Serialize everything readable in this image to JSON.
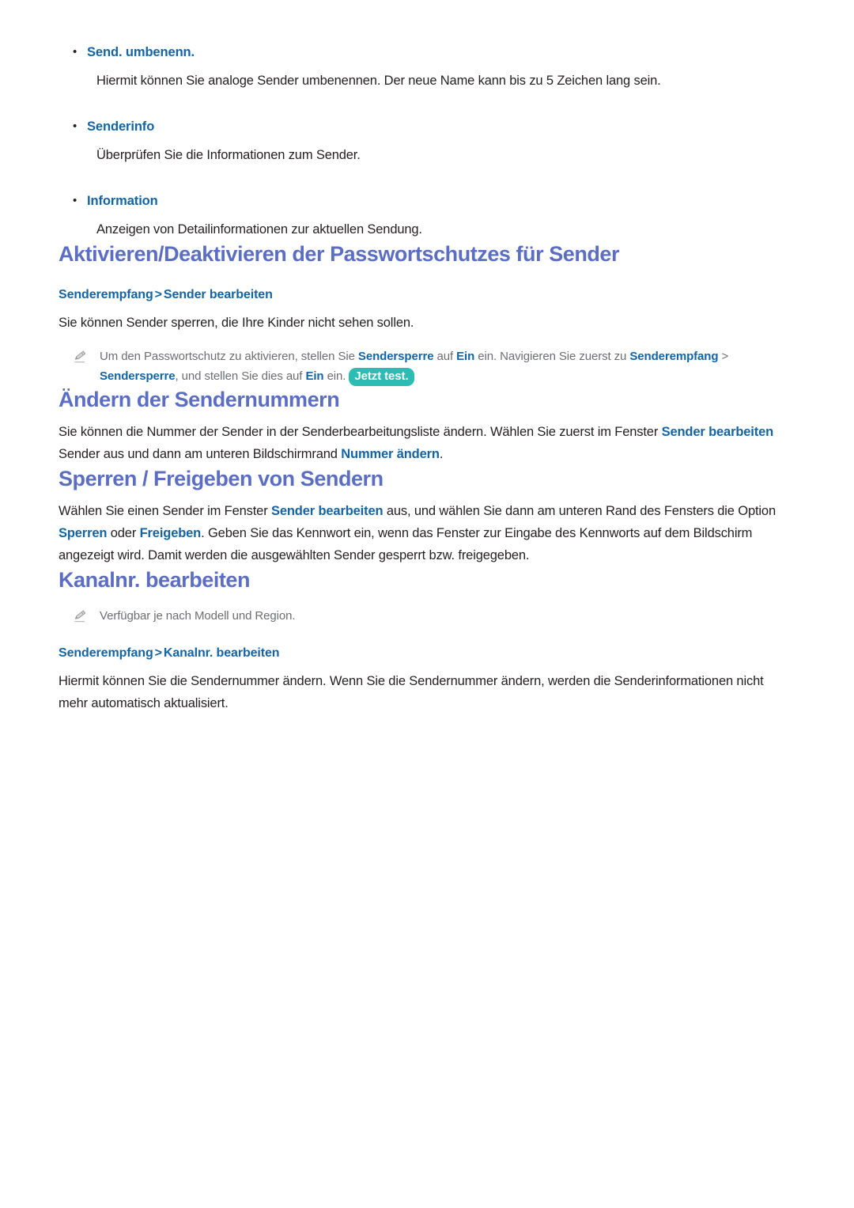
{
  "page": {
    "background_color": "#ffffff",
    "text_color": "#231f20",
    "heading_color": "#5b6ec3",
    "link_color": "#1364a5",
    "note_text_color": "#6d6e71",
    "badge_color": "#2cbcb3"
  },
  "bullets": [
    {
      "label": "Send. umbenenn.",
      "description": "Hiermit können Sie analoge Sender umbenennen. Der neue Name kann bis zu 5 Zeichen lang sein."
    },
    {
      "label": "Senderinfo",
      "description": "Überprüfen Sie die Informationen zum Sender."
    },
    {
      "label": "Information",
      "description": "Anzeigen von Detailinformationen zur aktuellen Sendung."
    }
  ],
  "sections": [
    {
      "title": "Aktivieren/Deaktivieren der Passwortschutzes für Sender",
      "breadcrumb": {
        "first": "Senderempfang",
        "separator": ">",
        "second": "Sender bearbeiten"
      },
      "paragraph": "Sie können Sender sperren, die Ihre Kinder nicht sehen sollen.",
      "note": {
        "icon": "pencil-icon",
        "part1": "Um den Passwortschutz zu aktivieren, stellen Sie ",
        "bold1": "Sendersperre",
        "part2": " auf ",
        "bold2": "Ein",
        "part3": " ein. Navigieren Sie zuerst zu ",
        "bold3": "Senderempfang",
        "part4": " > ",
        "bold4": "Sendersperre",
        "part5": ", und stellen Sie dies auf ",
        "bold5": "Ein",
        "part6": " ein. ",
        "badge": "Jetzt test."
      }
    },
    {
      "title": "Ändern der Sendernummern",
      "paragraph": {
        "part1": "Sie können die Nummer der Sender in der Senderbearbeitungsliste ändern. Wählen Sie zuerst im Fenster ",
        "bold1": "Sender bearbeiten",
        "part2": " Sender aus und dann am unteren Bildschirmrand ",
        "bold2": "Nummer ändern",
        "part3": "."
      }
    },
    {
      "title": "Sperren / Freigeben von Sendern",
      "paragraph": {
        "part1": "Wählen Sie einen Sender im Fenster ",
        "bold1": "Sender bearbeiten",
        "part2": " aus, und wählen Sie dann am unteren Rand des Fensters die Option ",
        "bold2": "Sperren",
        "part3": " oder ",
        "bold3": "Freigeben",
        "part4": ". Geben Sie das Kennwort ein, wenn das Fenster zur Eingabe des Kennworts auf dem Bildschirm angezeigt wird. Damit werden die ausgewählten Sender gesperrt bzw. freigegeben."
      }
    },
    {
      "title": "Kanalnr. bearbeiten",
      "note": {
        "icon": "pencil-icon",
        "text": "Verfügbar je nach Modell und Region."
      },
      "breadcrumb": {
        "first": "Senderempfang",
        "separator": ">",
        "second": "Kanalnr. bearbeiten"
      },
      "paragraph": "Hiermit können Sie die Sendernummer ändern. Wenn Sie die Sendernummer ändern, werden die Senderinformationen nicht mehr automatisch aktualisiert."
    }
  ],
  "bullet_glyph": "•"
}
